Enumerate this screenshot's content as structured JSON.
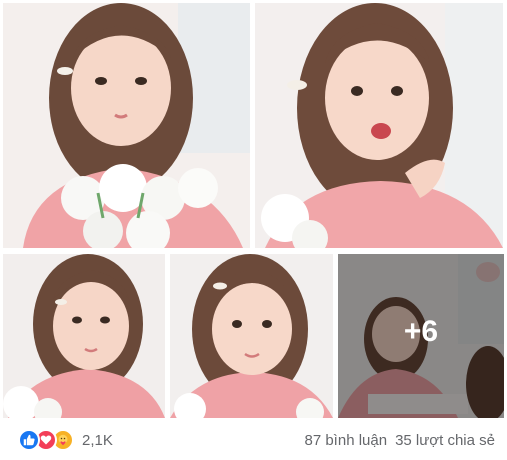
{
  "post": {
    "photos": [
      {
        "alt": "girl-with-white-roses"
      },
      {
        "alt": "girl-posing-hand-on-cheek"
      },
      {
        "alt": "girl-smiling-roses"
      },
      {
        "alt": "girl-looking-at-camera"
      },
      {
        "alt": "girl-at-table"
      }
    ],
    "more_photos_label": "+6"
  },
  "footer": {
    "reactions": [
      "like-icon",
      "love-icon",
      "care-icon"
    ],
    "reaction_count": "2,1K",
    "comments": "87 bình luận",
    "shares": "35 lượt chia sẻ"
  },
  "colors": {
    "like": "#1877f2",
    "love": "#f33e58",
    "care": "#f7b125",
    "meta_text": "#65676b"
  }
}
